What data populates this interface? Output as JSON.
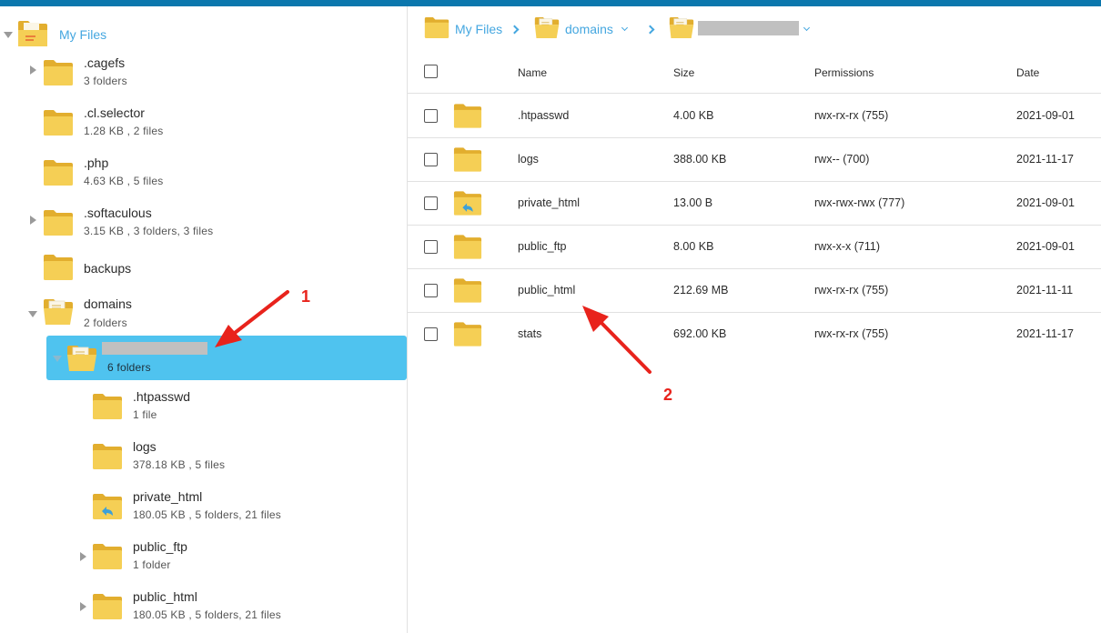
{
  "colors": {
    "accent": "#45a7e0",
    "selected": "#4fc3ef",
    "folder": "#f2c94c",
    "annotation": "#e8231c"
  },
  "tree": {
    "root": {
      "label": "My Files"
    },
    "items": [
      {
        "name": ".cagefs",
        "meta": "3 folders",
        "icon": "folder-icon"
      },
      {
        "name": ".cl.selector",
        "meta": "1.28 KB , 2 files",
        "icon": "folder-icon"
      },
      {
        "name": ".php",
        "meta": "4.63 KB , 5 files",
        "icon": "folder-icon"
      },
      {
        "name": ".softaculous",
        "meta": "3.15 KB , 3 folders, 3 files",
        "icon": "folder-icon"
      },
      {
        "name": "backups",
        "meta": "",
        "icon": "folder-icon"
      },
      {
        "name": "domains",
        "meta": "2 folders",
        "icon": "folder-open-icon"
      }
    ],
    "selected": {
      "meta": "6 folders",
      "icon": "folder-open-icon"
    },
    "children": [
      {
        "name": ".htpasswd",
        "meta": "1 file",
        "icon": "folder-icon"
      },
      {
        "name": "logs",
        "meta": "378.18 KB , 5 files",
        "icon": "folder-icon"
      },
      {
        "name": "private_html",
        "meta": "180.05 KB , 5 folders, 21 files",
        "icon": "folder-link-icon"
      },
      {
        "name": "public_ftp",
        "meta": "1 folder",
        "icon": "folder-icon"
      },
      {
        "name": "public_html",
        "meta": "180.05 KB , 5 folders, 21 files",
        "icon": "folder-icon"
      }
    ]
  },
  "breadcrumb": {
    "home": "My Files",
    "second": "domains"
  },
  "table": {
    "headers": {
      "name": "Name",
      "size": "Size",
      "permissions": "Permissions",
      "date": "Date"
    },
    "rows": [
      {
        "name": ".htpasswd",
        "size": "4.00 KB",
        "permissions": "rwx-rx-rx (755)",
        "date": "2021-09-01",
        "icon": "folder-icon"
      },
      {
        "name": "logs",
        "size": "388.00 KB",
        "permissions": "rwx-- (700)",
        "date": "2021-11-17",
        "icon": "folder-icon"
      },
      {
        "name": "private_html",
        "size": "13.00 B",
        "permissions": "rwx-rwx-rwx (777)",
        "date": "2021-09-01",
        "icon": "folder-link-icon"
      },
      {
        "name": "public_ftp",
        "size": "8.00 KB",
        "permissions": "rwx-x-x (711)",
        "date": "2021-09-01",
        "icon": "folder-icon"
      },
      {
        "name": "public_html",
        "size": "212.69 MB",
        "permissions": "rwx-rx-rx (755)",
        "date": "2021-11-11",
        "icon": "folder-icon"
      },
      {
        "name": "stats",
        "size": "692.00 KB",
        "permissions": "rwx-rx-rx (755)",
        "date": "2021-11-17",
        "icon": "folder-icon"
      }
    ]
  },
  "annotations": {
    "one": "1",
    "two": "2"
  }
}
